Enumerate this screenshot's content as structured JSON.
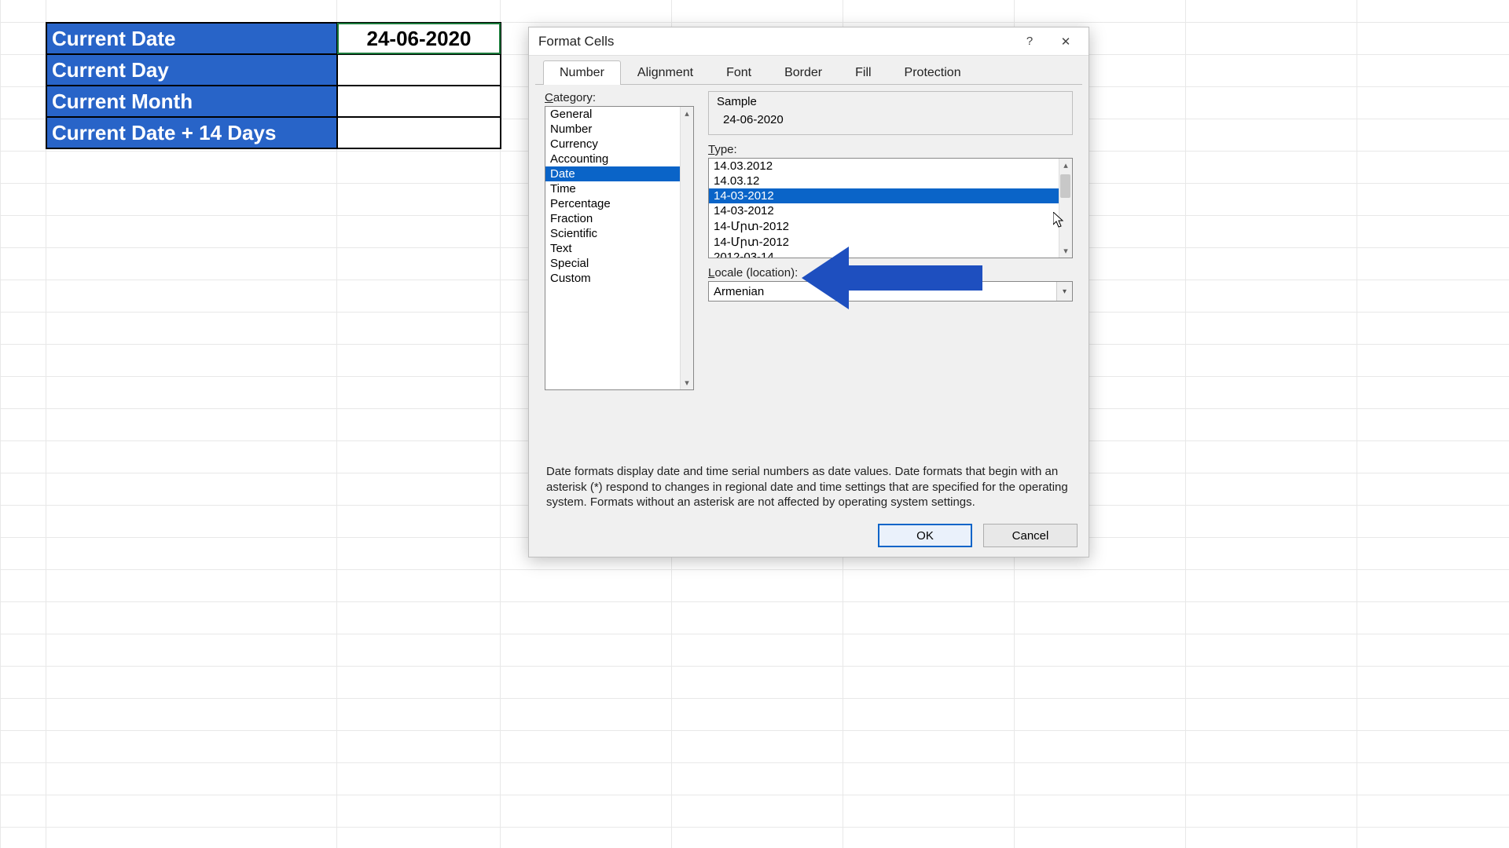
{
  "sheet": {
    "rows": [
      {
        "label": "Current Date",
        "value": "24-06-2020"
      },
      {
        "label": "Current Day",
        "value": ""
      },
      {
        "label": "Current Month",
        "value": ""
      },
      {
        "label": "Current Date + 14 Days",
        "value": ""
      }
    ]
  },
  "dialog": {
    "title": "Format Cells",
    "help_char": "?",
    "close_char": "✕",
    "tabs": [
      "Number",
      "Alignment",
      "Font",
      "Border",
      "Fill",
      "Protection"
    ],
    "active_tab": "Number",
    "category_label": "Category:",
    "categories": [
      "General",
      "Number",
      "Currency",
      "Accounting",
      "Date",
      "Time",
      "Percentage",
      "Fraction",
      "Scientific",
      "Text",
      "Special",
      "Custom"
    ],
    "category_selected": "Date",
    "sample_label": "Sample",
    "sample_value": "24-06-2020",
    "type_label": "Type:",
    "types": [
      "14.03.2012",
      "14.03.12",
      "14-03-2012",
      "14-03-2012",
      "14-Մրտ-2012",
      "14-Մրտ-2012",
      "2012-03-14"
    ],
    "type_selected_index": 2,
    "locale_label": "Locale (location):",
    "locale_value": "Armenian",
    "description": "Date formats display date and time serial numbers as date values.  Date formats that begin with an asterisk (*) respond to changes in regional date and time settings that are specified for the operating system. Formats without an asterisk are not affected by operating system settings.",
    "ok_label": "OK",
    "cancel_label": "Cancel"
  }
}
